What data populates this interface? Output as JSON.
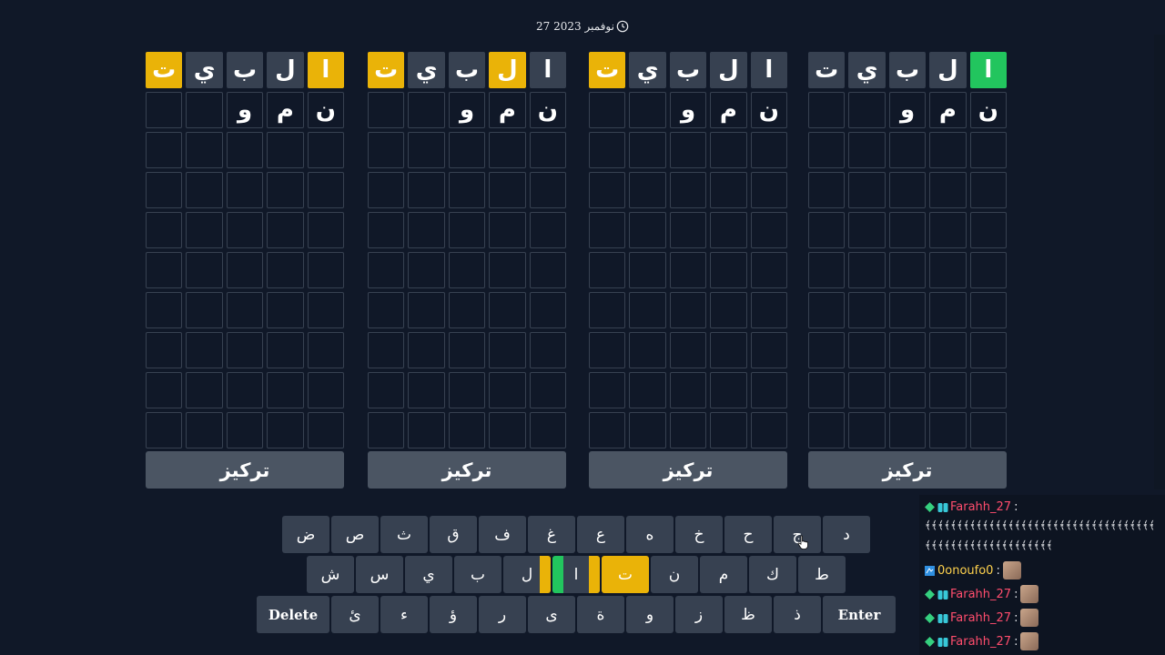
{
  "date": "27 نوفمبر 2023",
  "icons": {
    "clock": "clock-icon",
    "cursor": "hand-pointer-icon"
  },
  "colors": {
    "background": "#101828",
    "gray": "#374151",
    "green": "#22c55e",
    "yellow": "#eab308",
    "button": "#4b5563"
  },
  "boards": [
    {
      "focus_label": "تركيز",
      "rows": [
        [
          {
            "l": "ا",
            "s": "green"
          },
          {
            "l": "ل",
            "s": "gray"
          },
          {
            "l": "ب",
            "s": "gray"
          },
          {
            "l": "ي",
            "s": "gray"
          },
          {
            "l": "ت",
            "s": "gray"
          }
        ],
        [
          {
            "l": "ن",
            "s": "typed"
          },
          {
            "l": "م",
            "s": "typed"
          },
          {
            "l": "و",
            "s": "typed"
          },
          {
            "l": "",
            "s": "empty"
          },
          {
            "l": "",
            "s": "empty"
          }
        ]
      ]
    },
    {
      "focus_label": "تركيز",
      "rows": [
        [
          {
            "l": "ا",
            "s": "gray"
          },
          {
            "l": "ل",
            "s": "gray"
          },
          {
            "l": "ب",
            "s": "gray"
          },
          {
            "l": "ي",
            "s": "gray"
          },
          {
            "l": "ت",
            "s": "yellow"
          }
        ],
        [
          {
            "l": "ن",
            "s": "typed"
          },
          {
            "l": "م",
            "s": "typed"
          },
          {
            "l": "و",
            "s": "typed"
          },
          {
            "l": "",
            "s": "empty"
          },
          {
            "l": "",
            "s": "empty"
          }
        ]
      ]
    },
    {
      "focus_label": "تركيز",
      "rows": [
        [
          {
            "l": "ا",
            "s": "gray"
          },
          {
            "l": "ل",
            "s": "yellow"
          },
          {
            "l": "ب",
            "s": "gray"
          },
          {
            "l": "ي",
            "s": "gray"
          },
          {
            "l": "ت",
            "s": "yellow"
          }
        ],
        [
          {
            "l": "ن",
            "s": "typed"
          },
          {
            "l": "م",
            "s": "typed"
          },
          {
            "l": "و",
            "s": "typed"
          },
          {
            "l": "",
            "s": "empty"
          },
          {
            "l": "",
            "s": "empty"
          }
        ]
      ]
    },
    {
      "focus_label": "تركيز",
      "rows": [
        [
          {
            "l": "ا",
            "s": "yellow"
          },
          {
            "l": "ل",
            "s": "gray"
          },
          {
            "l": "ب",
            "s": "gray"
          },
          {
            "l": "ي",
            "s": "gray"
          },
          {
            "l": "ت",
            "s": "yellow"
          }
        ],
        [
          {
            "l": "ن",
            "s": "typed"
          },
          {
            "l": "م",
            "s": "typed"
          },
          {
            "l": "و",
            "s": "typed"
          },
          {
            "l": "",
            "s": "empty"
          },
          {
            "l": "",
            "s": "empty"
          }
        ]
      ]
    }
  ],
  "keyboard": {
    "row1": [
      "د",
      "ج",
      "ح",
      "خ",
      "ه",
      "ع",
      "غ",
      "ف",
      "ق",
      "ث",
      "ص",
      "ض"
    ],
    "row2": [
      {
        "l": "ط",
        "s": "gray"
      },
      {
        "l": "ك",
        "s": "gray"
      },
      {
        "l": "م",
        "s": "gray"
      },
      {
        "l": "ن",
        "s": "gray"
      },
      {
        "l": "ت",
        "s": "yellow"
      },
      {
        "l": "ا",
        "s": "split",
        "bars": [
          "yellow",
          "green"
        ]
      },
      {
        "l": "ل",
        "s": "split2",
        "bars": [
          "yellow"
        ]
      },
      {
        "l": "ب",
        "s": "gray"
      },
      {
        "l": "ي",
        "s": "gray"
      },
      {
        "l": "س",
        "s": "gray"
      },
      {
        "l": "ش",
        "s": "gray"
      }
    ],
    "row3": [
      "ذ",
      "ظ",
      "ز",
      "و",
      "ة",
      "ى",
      "ر",
      "ؤ",
      "ء",
      "ئ"
    ],
    "enter_label": "Enter",
    "delete_label": "Delete"
  },
  "chat": {
    "messages": [
      {
        "user": "Farahh_27",
        "color": "red",
        "text": ":",
        "avatar": false
      },
      {
        "spam": "﴾﴾﴾﴾﴾﴾﴾﴾﴾﴾﴾﴾﴾﴾﴾﴾﴾﴾﴾﴾﴾﴾﴾﴾﴾﴾﴾﴾﴾﴾﴾﴾﴾﴾﴾﴾"
      },
      {
        "spam": "﴾﴾﴾﴾﴾﴾﴾﴾﴾﴾﴾﴾﴾﴾﴾﴾﴾﴾﴾﴾"
      },
      {
        "user": "0onoufo0",
        "color": "orange",
        "text": ":",
        "avatar": true
      },
      {
        "user": "Farahh_27",
        "color": "red",
        "text": ":",
        "avatar": true
      },
      {
        "user": "Farahh_27",
        "color": "red",
        "text": ":",
        "avatar": true
      },
      {
        "user": "Farahh_27",
        "color": "red",
        "text": ":",
        "avatar": true
      }
    ]
  }
}
